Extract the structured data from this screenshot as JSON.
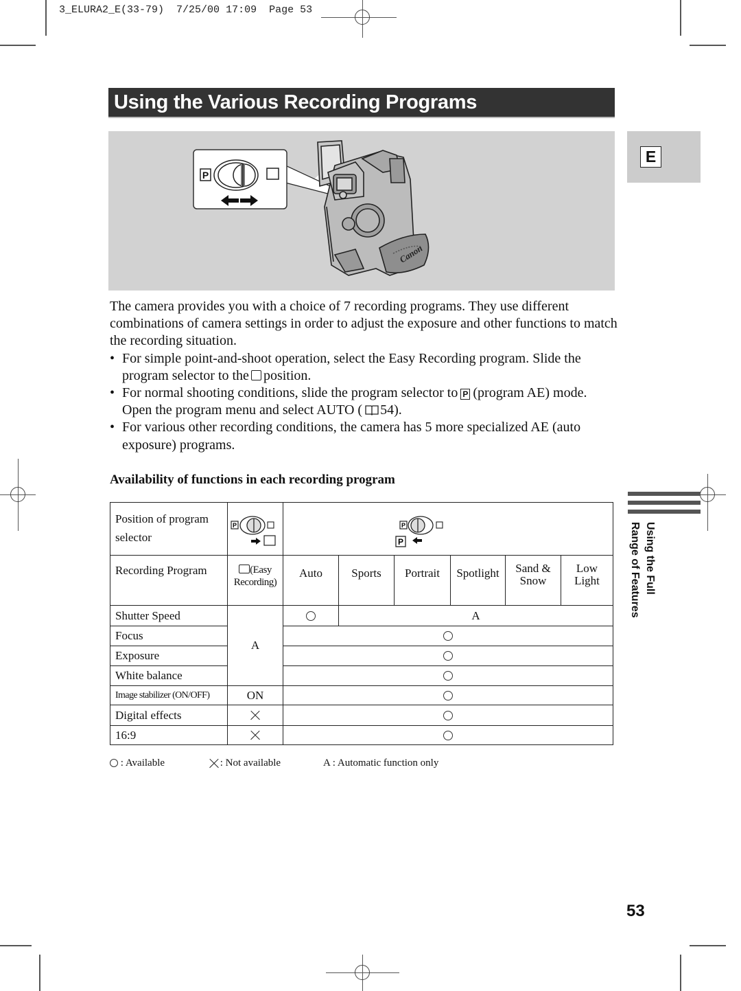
{
  "slug": {
    "file": "3_ELURA2_E(33-79)",
    "date": "7/25/00",
    "time": "17:09",
    "page_label": "Page",
    "page": "53"
  },
  "title": "Using the Various Recording Programs",
  "illustration": {
    "selector_left_label": "P",
    "brand": "Canon",
    "arrows": "left-right-arrows-icon"
  },
  "language_tab": "E",
  "intro": "The camera provides you with a choice of 7 recording programs. They use different combinations of camera settings in order to adjust the exposure and other functions to match the recording situation.",
  "bullets": [
    {
      "before": "For simple point-and-shoot operation, select the Easy Recording program. Slide the program selector to the",
      "icon": "easy-recording-square-icon",
      "after": "position."
    },
    {
      "before": "For normal shooting conditions, slide the program selector to",
      "icon": "program-ae-p-icon",
      "icon_text": "P",
      "middle": "(program AE) mode. Open the program menu and select AUTO (",
      "ref_icon": "book-reference-icon",
      "ref_page": "54",
      "after": ")."
    },
    {
      "before": "For various other recording conditions, the camera has 5 more specialized AE (auto exposure) programs."
    }
  ],
  "table_title": "Availability of functions in each recording program",
  "table": {
    "selector_row_label": "Position of program selector",
    "selector_easy_icon": "selector-easy-position-icon",
    "selector_p_icon": "selector-p-position-icon",
    "selector_p_label": "P",
    "program_row_label": "Recording Program",
    "programs": [
      {
        "name": "(Easy Recording)",
        "line1": "(Easy",
        "line2": "Recording)"
      },
      {
        "name": "Auto",
        "line1": "Auto"
      },
      {
        "name": "Sports",
        "line1": "Sports"
      },
      {
        "name": "Portrait",
        "line1": "Portrait"
      },
      {
        "name": "Spotlight",
        "line1": "Spotlight"
      },
      {
        "name": "Sand & Snow",
        "line1": "Sand &",
        "line2": "Snow"
      },
      {
        "name": "Low Light",
        "line1": "Low",
        "line2": "Light"
      }
    ],
    "rows": [
      {
        "function": "Shutter Speed",
        "easy": "A",
        "auto": "○",
        "others": "A"
      },
      {
        "function": "Focus",
        "easy": "A",
        "auto": "○",
        "others": "○"
      },
      {
        "function": "Exposure",
        "easy": "A",
        "auto": "○",
        "others": "○"
      },
      {
        "function": "White balance",
        "easy": "A",
        "auto": "○",
        "others": "○"
      },
      {
        "function": "Image stabilizer (ON/OFF)",
        "easy": "ON",
        "auto": "○",
        "others": "○"
      },
      {
        "function": "Digital effects",
        "easy": "×",
        "auto": "○",
        "others": "○"
      },
      {
        "function": "16:9",
        "easy": "×",
        "auto": "○",
        "others": "○"
      }
    ],
    "easy_merged_value": "A"
  },
  "legend": [
    {
      "symbol": "○",
      "text": ": Available"
    },
    {
      "symbol": "×",
      "text": ": Not available"
    },
    {
      "symbol": "A",
      "text": " : Automatic function only"
    }
  ],
  "side_label": [
    "Using the Full",
    "Range of Features"
  ],
  "page_number": "53"
}
